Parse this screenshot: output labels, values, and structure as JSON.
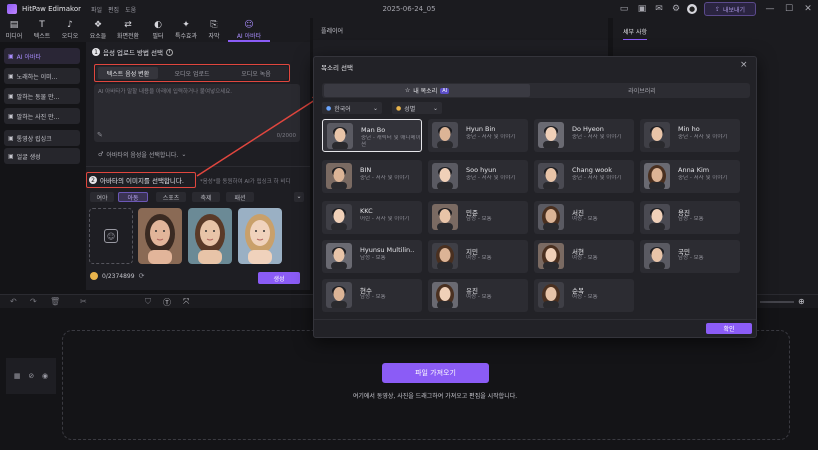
{
  "app": {
    "name": "HitPaw Edimakor",
    "menu": [
      "파일",
      "편집",
      "도움"
    ],
    "date": "2025-06-24_05",
    "export_label": "내보내기"
  },
  "toolbar": [
    {
      "label": "미디어",
      "icon": "media-icon"
    },
    {
      "label": "텍스트",
      "icon": "text-icon"
    },
    {
      "label": "오디오",
      "icon": "audio-icon"
    },
    {
      "label": "요소들",
      "icon": "elements-icon"
    },
    {
      "label": "화면전환",
      "icon": "transition-icon"
    },
    {
      "label": "필터",
      "icon": "filter-icon"
    },
    {
      "label": "특수효과",
      "icon": "effects-icon"
    },
    {
      "label": "자막",
      "icon": "subtitle-icon"
    },
    {
      "label": "AI 아바타",
      "icon": "ai-avatar-icon",
      "active": true
    }
  ],
  "sidebar": [
    {
      "label": "AI 아바타",
      "selected": true
    },
    {
      "label": "노래하는 이미..."
    },
    {
      "label": "말하는 동물 만..."
    },
    {
      "label": "말하는 사진 만..."
    },
    {
      "label": "통영상 립싱크"
    },
    {
      "label": "얼굴 생성"
    }
  ],
  "panel": {
    "step1_label": "음성 업로드 방법 선택",
    "mode_tabs": [
      "텍스트 음성 변환",
      "오디오 업로드",
      "오디오 녹음"
    ],
    "textarea_placeholder": "AI 아바타가 말할 내용을 아래에 입력하거나 붙여넣으세요.",
    "char_count": "0/2000",
    "voice_select_label": "아바타의 음성을 선택합니다.",
    "step2_label": "아바타의 이미지를 선택합니다.",
    "step2_hint": "*음성*을 동원하여 AI가 립싱크 하 비디",
    "filter_tabs": [
      "여야",
      "아동",
      "스포츠",
      "축제",
      "패션"
    ],
    "selected_filter": 1,
    "credits": "0/2374899",
    "generate_label": "생성"
  },
  "preview": {
    "title": "플레이어"
  },
  "details": {
    "tab": "세부 사항"
  },
  "timeline": {
    "import_button": "파일 가져오기",
    "import_hint": "여기에서 동영상, 사진을 드래그하여 가져오고 편집을 시작합니다."
  },
  "modal": {
    "title": "목소리 선택",
    "tabs": [
      {
        "label": "내 목소리",
        "badge": "AI"
      },
      {
        "label": "라이브러리"
      }
    ],
    "language": "한국어",
    "gender": "성별",
    "confirm": "확인",
    "voices": [
      {
        "name": "Man Bo",
        "desc": "중년 - 캐릭터 및 애니메이션",
        "gender": "m",
        "selected": true
      },
      {
        "name": "Hyun Bin",
        "desc": "중년 - 서사 및 이야기",
        "gender": "m"
      },
      {
        "name": "Do Hyeon",
        "desc": "중년 - 서사 및 이야기",
        "gender": "m"
      },
      {
        "name": "Min ho",
        "desc": "중년 - 서사 및 이야기",
        "gender": "m"
      },
      {
        "name": "BIN",
        "desc": "중년 - 서사 및 이야기",
        "gender": "m"
      },
      {
        "name": "Soo hyun",
        "desc": "중년 - 서사 및 이야기",
        "gender": "m"
      },
      {
        "name": "Chang wook",
        "desc": "중년 - 서사 및 이야기",
        "gender": "m"
      },
      {
        "name": "Anna Kim",
        "desc": "중년 - 서사 및 이야기",
        "gender": "f"
      },
      {
        "name": "KKC",
        "desc": "어린 - 서사 및 이야기",
        "gender": "m"
      },
      {
        "name": "민준",
        "desc": "남성 - 보통",
        "gender": "m"
      },
      {
        "name": "서진",
        "desc": "여성 - 보통",
        "gender": "f"
      },
      {
        "name": "용진",
        "desc": "남성 - 보통",
        "gender": "m"
      },
      {
        "name": "Hyunsu Multilin..",
        "desc": "남성 - 보통",
        "gender": "m"
      },
      {
        "name": "지민",
        "desc": "여성 - 보통",
        "gender": "f"
      },
      {
        "name": "서현",
        "desc": "여성 - 보통",
        "gender": "f"
      },
      {
        "name": "국민",
        "desc": "남성 - 보통",
        "gender": "m"
      },
      {
        "name": "현수",
        "desc": "남성 - 보통",
        "gender": "m"
      },
      {
        "name": "유진",
        "desc": "여성 - 보통",
        "gender": "f"
      },
      {
        "name": "순복",
        "desc": "여성 - 보통",
        "gender": "f"
      }
    ]
  },
  "colors": {
    "accent": "#8b5cf6",
    "highlight_red": "#e0463e"
  }
}
